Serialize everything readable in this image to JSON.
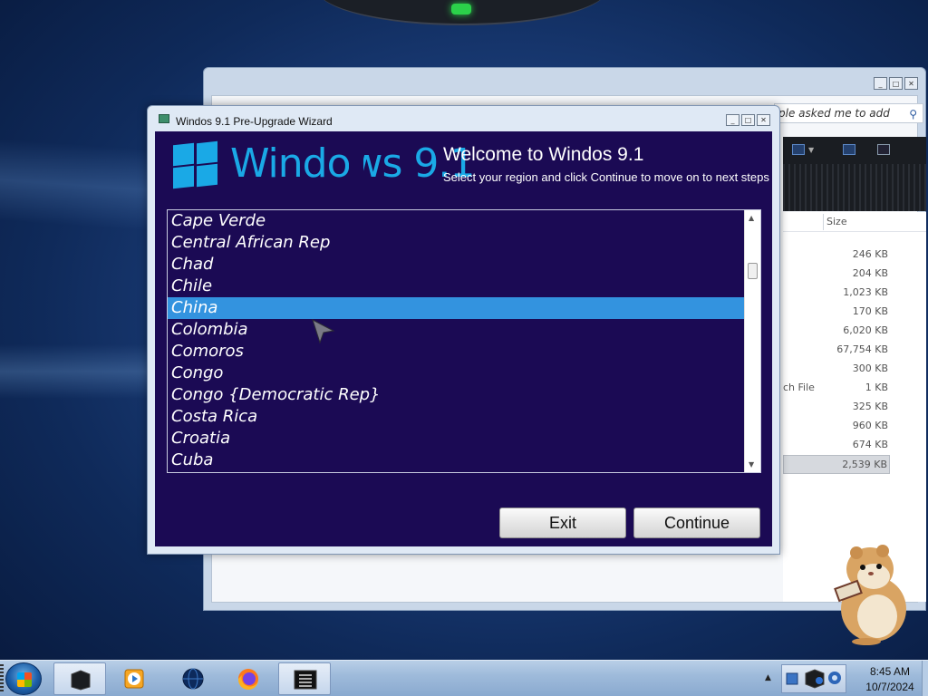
{
  "wizard": {
    "title": "Windos 9.1 Pre-Upgrade Wizard",
    "logo_text": "Windows 9.1",
    "welcome_title": "Welcome to Windos 9.1",
    "welcome_subtitle": "Select your region and click Continue to move on to next steps",
    "regions": [
      "Cape Verde",
      "Central African Rep",
      "Chad",
      "Chile",
      "China",
      "Colombia",
      "Comoros",
      "Congo",
      "Congo {Democratic Rep}",
      "Costa Rica",
      "Croatia",
      "Cuba"
    ],
    "selected_region": "China",
    "exit_label": "Exit",
    "continue_label": "Continue",
    "accent_color": "#1aa9e6",
    "background_color": "#1b0a54",
    "selection_color": "#3393df"
  },
  "explorer": {
    "search_text": "ple asked me to add",
    "column_size": "Size",
    "rows": [
      {
        "type": "",
        "size": "246 KB"
      },
      {
        "type": "",
        "size": "204 KB"
      },
      {
        "type": "",
        "size": "1,023 KB"
      },
      {
        "type": "",
        "size": "170 KB"
      },
      {
        "type": "",
        "size": "6,020 KB"
      },
      {
        "type": "",
        "size": "67,754 KB"
      },
      {
        "type": "",
        "size": "300 KB"
      },
      {
        "type": "ch File",
        "size": "1 KB"
      },
      {
        "type": "",
        "size": "325 KB"
      },
      {
        "type": "",
        "size": "960 KB"
      },
      {
        "type": "",
        "size": "674 KB"
      },
      {
        "type": "",
        "size": "2,539 KB"
      }
    ],
    "selected_row": 11
  },
  "taskbar": {
    "items": [
      "start-orb",
      "black-window-icon",
      "media-player-icon",
      "globe-icon",
      "firefox-icon",
      "terminal-icon"
    ],
    "clock_time": "8:45 AM",
    "clock_date": "10/7/2024"
  }
}
